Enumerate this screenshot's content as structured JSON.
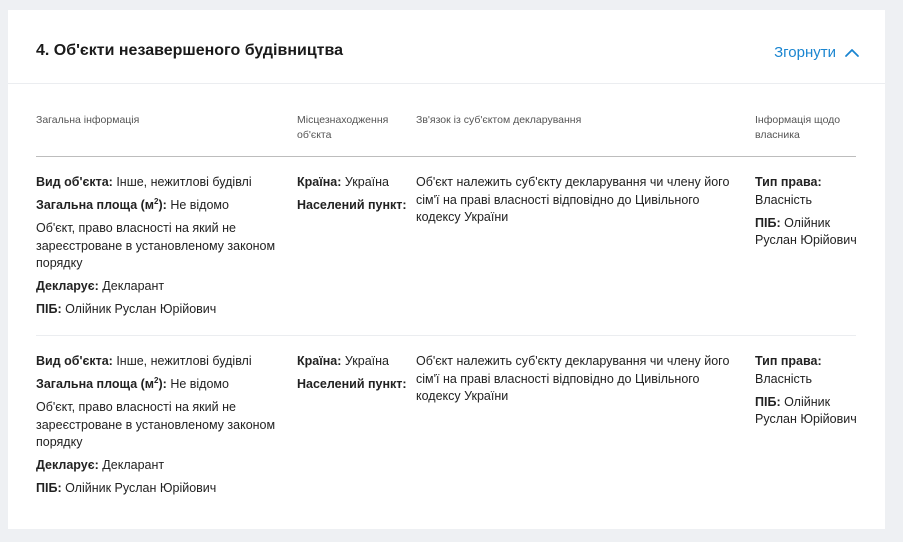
{
  "section": {
    "title": "4. Об'єкти незавершеного будівництва",
    "collapse_label": "Згорнути"
  },
  "table": {
    "headers": [
      "Загальна інформація",
      "Місцезнаходження об'єкта",
      "Зв'язок із суб'єктом декларування",
      "Інформація щодо власника"
    ],
    "labels": {
      "object_type": "Вид об'єкта:",
      "area_prefix": "Загальна площа (м",
      "area_exp": "2",
      "area_suffix": "):",
      "declarant": "Декларує:",
      "pib": "ПІБ:",
      "country": "Країна:",
      "settlement": "Населений пункт:",
      "right_type": "Тип права:"
    },
    "rows": [
      {
        "object_type": "Інше, нежитлові будівлі",
        "area": "Не відомо",
        "note": "Об'єкт, право власності на який не зареєстроване в установленому законом порядку",
        "declarant": "Декларант",
        "pib": "Олійник Руслан Юрійович",
        "country": "Україна",
        "settlement": "",
        "relation": "Об'єкт належить суб'єкту декларування чи члену його сім'ї на праві власності відповідно до Цивільного кодексу України",
        "right_type": "Власність",
        "owner_pib": "Олійник Руслан Юрійович"
      },
      {
        "object_type": "Інше, нежитлові будівлі",
        "area": "Не відомо",
        "note": "Об'єкт, право власності на який не зареєстроване в установленому законом порядку",
        "declarant": "Декларант",
        "pib": "Олійник Руслан Юрійович",
        "country": "Україна",
        "settlement": "",
        "relation": "Об'єкт належить суб'єкту декларування чи члену його сім'ї на праві власності відповідно до Цивільного кодексу України",
        "right_type": "Власність",
        "owner_pib": "Олійник Руслан Юрійович"
      }
    ]
  },
  "colors": {
    "accent": "#1a85d0",
    "page_bg": "#eef0f3",
    "card_bg": "#ffffff"
  },
  "icons": {
    "collapse": "chevron-up-icon"
  }
}
